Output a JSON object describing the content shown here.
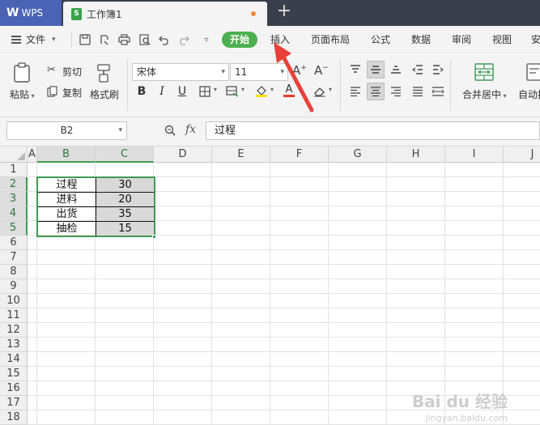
{
  "titlebar": {
    "app_name": "WPS",
    "doc_tab": "工作簿1",
    "new_tab": "+"
  },
  "menubar": {
    "file_label": "文件",
    "tabs": [
      "开始",
      "插入",
      "页面布局",
      "公式",
      "数据",
      "审阅",
      "视图",
      "安"
    ]
  },
  "ribbon": {
    "paste_label": "粘贴",
    "cut_label": "剪切",
    "copy_label": "复制",
    "format_painter_label": "格式刷",
    "font_name": "宋体",
    "font_size": "11",
    "merge_center_label": "合并居中",
    "wrap_label": "自动换"
  },
  "formulabar": {
    "cell_ref": "B2",
    "fx": "fx",
    "formula_value": "过程"
  },
  "sheet": {
    "columns": [
      "A",
      "B",
      "C",
      "D",
      "E",
      "F",
      "G",
      "H",
      "I",
      "J"
    ],
    "rows": [
      "1",
      "2",
      "3",
      "4",
      "5",
      "6",
      "7",
      "8",
      "9",
      "10",
      "11",
      "12",
      "13",
      "14",
      "15",
      "16",
      "17",
      "18"
    ],
    "table": [
      {
        "label": "过程",
        "value": "30"
      },
      {
        "label": "进料",
        "value": "20"
      },
      {
        "label": "出货",
        "value": "35"
      },
      {
        "label": "抽检",
        "value": "15"
      }
    ]
  },
  "watermark": {
    "text": "Bai du 经验",
    "sub": "jingyan.baidu.com"
  },
  "colors": {
    "accent_green": "#4caf50",
    "selection_green": "#3f9a54",
    "wps_blue": "#4a63b5",
    "arrow_red": "#e8413a"
  }
}
